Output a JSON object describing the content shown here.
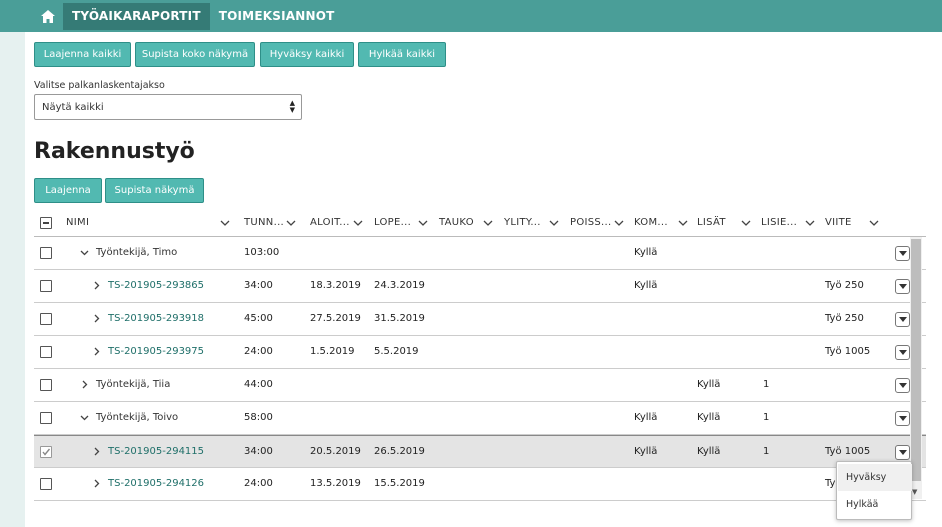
{
  "nav": {
    "home_icon": "home-icon",
    "tabs": [
      {
        "label": "TYÖAIKARAPORTIT",
        "active": true
      },
      {
        "label": "TOIMEKSIANNOT",
        "active": false
      }
    ]
  },
  "toolbar": {
    "expand_all": "Laajenna kaikki",
    "collapse_all": "Supista koko näkymä",
    "approve_all": "Hyväksy kaikki",
    "reject_all": "Hylkää kaikki"
  },
  "period": {
    "label": "Valitse palkanlaskentajakso",
    "value": "Näytä kaikki"
  },
  "section": {
    "title": "Rakennustyö",
    "expand": "Laajenna",
    "collapse": "Supista näkymä"
  },
  "table": {
    "columns": [
      "NIMI",
      "TUNN...",
      "ALOIT...",
      "LOPE...",
      "TAUKO",
      "YLITY...",
      "POISS...",
      "KOM...",
      "LISÄT",
      "LISIE...",
      "VIITE"
    ],
    "rows": [
      {
        "name": "Työntekijä, Timo",
        "level": 0,
        "expanded": true,
        "hours": "103:00",
        "start": "",
        "end": "",
        "kom": "Kyllä",
        "lisat": "",
        "lisie": "",
        "viite": "",
        "checked": false
      },
      {
        "name": "TS-201905-293865",
        "level": 1,
        "expanded": false,
        "hours": "34:00",
        "start": "18.3.2019",
        "end": "24.3.2019",
        "kom": "Kyllä",
        "lisat": "",
        "lisie": "",
        "viite": "Työ 250",
        "checked": false
      },
      {
        "name": "TS-201905-293918",
        "level": 1,
        "expanded": false,
        "hours": "45:00",
        "start": "27.5.2019",
        "end": "31.5.2019",
        "kom": "",
        "lisat": "",
        "lisie": "",
        "viite": "Työ 250",
        "checked": false
      },
      {
        "name": "TS-201905-293975",
        "level": 1,
        "expanded": false,
        "hours": "24:00",
        "start": "1.5.2019",
        "end": "5.5.2019",
        "kom": "",
        "lisat": "",
        "lisie": "",
        "viite": "Työ 1005",
        "checked": false
      },
      {
        "name": "Työntekijä, Tiia",
        "level": 0,
        "expanded": false,
        "hours": "44:00",
        "start": "",
        "end": "",
        "kom": "",
        "lisat": "Kyllä",
        "lisie": "1",
        "viite": "",
        "checked": false
      },
      {
        "name": "Työntekijä, Toivo",
        "level": 0,
        "expanded": true,
        "hours": "58:00",
        "start": "",
        "end": "",
        "kom": "Kyllä",
        "lisat": "Kyllä",
        "lisie": "1",
        "viite": "",
        "checked": false
      },
      {
        "name": "TS-201905-294115",
        "level": 1,
        "expanded": false,
        "hours": "34:00",
        "start": "20.5.2019",
        "end": "26.5.2019",
        "kom": "Kyllä",
        "lisat": "Kyllä",
        "lisie": "1",
        "viite": "Työ 1005",
        "checked": true
      },
      {
        "name": "TS-201905-294126",
        "level": 1,
        "expanded": false,
        "hours": "24:00",
        "start": "13.5.2019",
        "end": "15.5.2019",
        "kom": "",
        "lisat": "",
        "lisie": "",
        "viite": "Ty",
        "checked": false
      }
    ]
  },
  "row_menu": {
    "approve": "Hyväksy",
    "reject": "Hylkää"
  },
  "colors": {
    "accent": "#4a9e98",
    "accent_dark": "#357b76",
    "button": "#52b9b1",
    "link": "#1f6f69"
  }
}
